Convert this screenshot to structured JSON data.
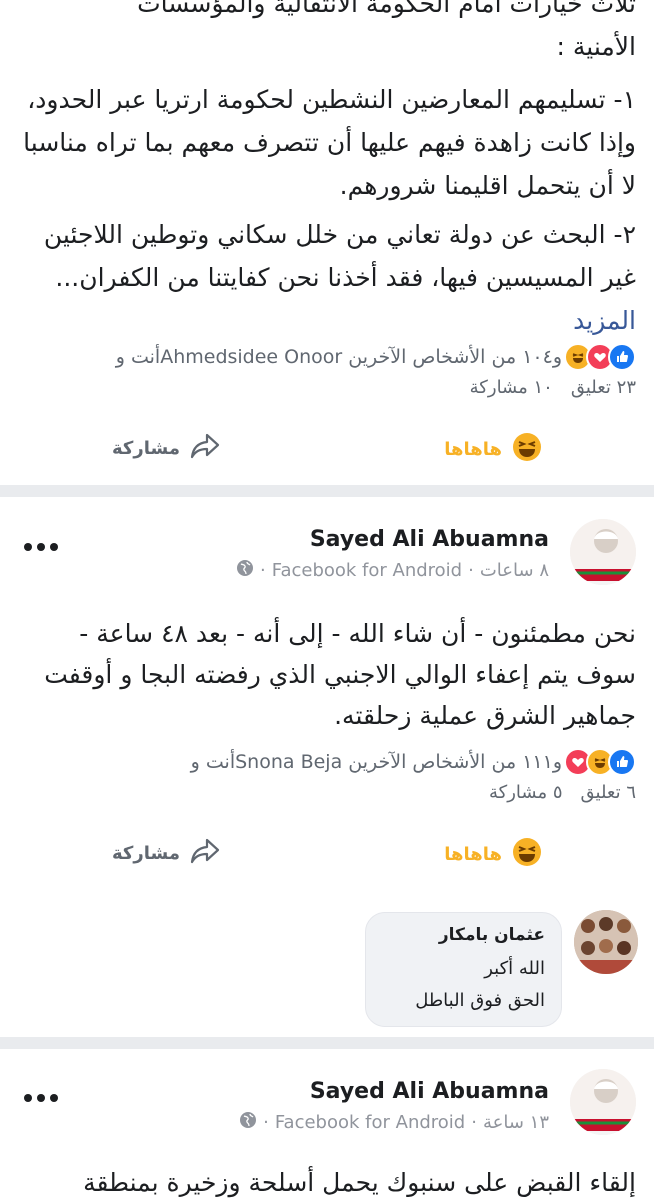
{
  "post1": {
    "text_line0": "ثلاث خيارات أمام الحكومة الانتقالية والمؤسسات",
    "text_line1": "الأمنية :",
    "item1": "١- تسليمهم المعارضين النشطين لحكومة ارتريا عبر الحدود، وإذا كانت زاهدة فيهم عليها أن تتصرف معهم بما تراه مناسبا لا أن يتحمل اقليمنا شرورهم.",
    "item2": "٢- البحث عن دولة تعاني من خلل سكاني وتوطين اللاجئين غير المسيسين فيها، فقد أخذنا نحن كفايتنا من الكفران...",
    "more": "المزيد",
    "reactions": "أنت وAhmedsidee Onoor و١٠٤ من الأشخاص الآخرين",
    "comments": "٢٣ تعليق",
    "shares": "١٠ مشاركة",
    "reacted_label": "هاهاها",
    "share_label": "مشاركة"
  },
  "post2": {
    "author": "Sayed Ali Abuamna",
    "time": "٨ ساعات",
    "source": "Facebook for Android",
    "text": "نحن مطمئنون - أن شاء الله - إلى أنه - بعد ٤٨ ساعة - سوف يتم إعفاء الوالي الاجنبي الذي رفضته البجا و أوقفت جماهير الشرق عملية زحلقته.",
    "reactions": "أنت وSnona Beja و١١١ من الأشخاص الآخرين",
    "comments": "٦ تعليق",
    "shares": "٥ مشاركة",
    "reacted_label": "هاهاها",
    "share_label": "مشاركة",
    "comment": {
      "author": "عثمان بامكار",
      "line1": "الله أكبر",
      "line2": "الحق فوق الباطل"
    }
  },
  "post3": {
    "author": "Sayed Ali Abuamna",
    "time": "١٣ ساعة",
    "source": "Facebook for Android",
    "text": "إلقاء القبض على سنبوك يحمل أسلحة وزخيرة بمنطقة"
  },
  "colors": {
    "like": "#1877f2",
    "love": "#f33e58",
    "haha": "#f7b125",
    "link": "#385898",
    "muted": "#606770"
  }
}
